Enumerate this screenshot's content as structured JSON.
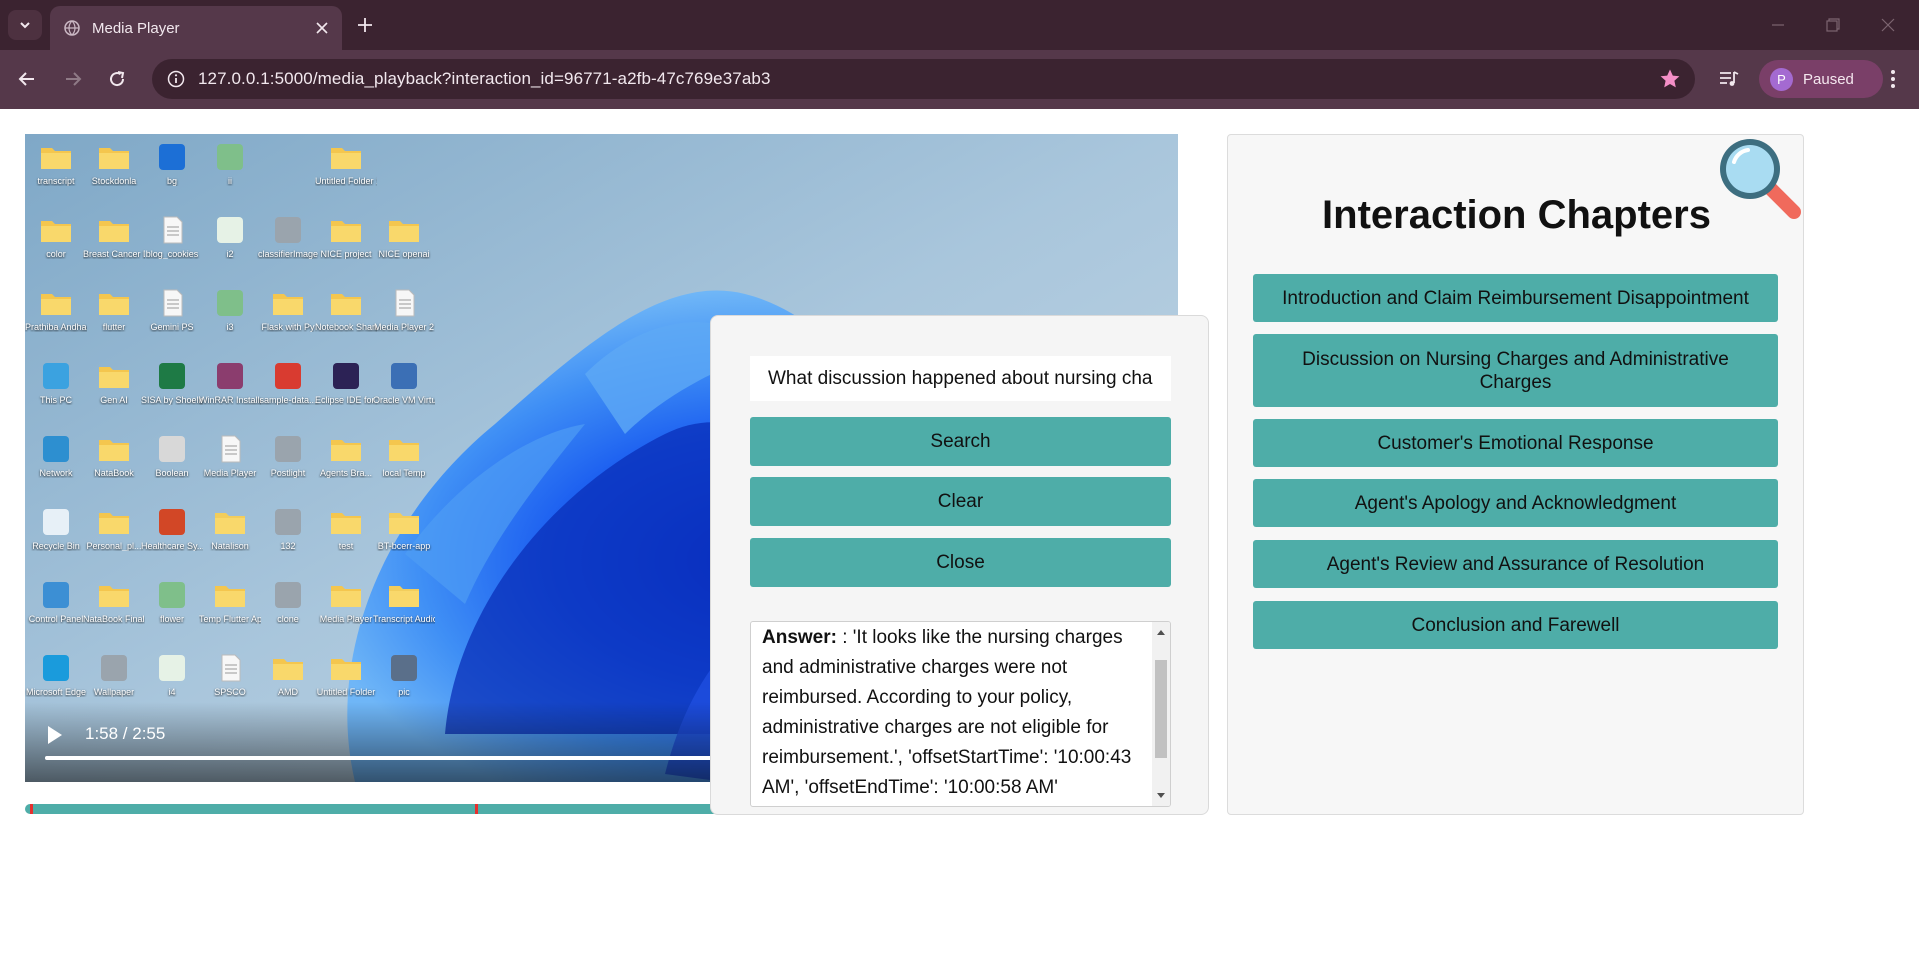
{
  "browser": {
    "tab_title": "Media Player",
    "url": "127.0.0.1:5000/media_playback?interaction_id=96771-a2fb-47c769e37ab3",
    "profile_initial": "P",
    "profile_label": "Paused",
    "accent_color": "#f48fc7"
  },
  "video": {
    "time_display": "1:58 / 2:55",
    "progress_fraction": 0.674,
    "desktop_icons": [
      {
        "label": "transcript",
        "icon": "folder-icon"
      },
      {
        "label": "Stockdonla",
        "icon": "folder-icon"
      },
      {
        "label": "bg",
        "icon": "phone-image-icon"
      },
      {
        "label": "ii",
        "icon": "app-icon"
      },
      {
        "label": "Untitled Folder 1",
        "icon": "folder-icon"
      },
      {
        "label": "color",
        "icon": "folder-icon"
      },
      {
        "label": "Breast Cancer Detection",
        "icon": "folder-icon"
      },
      {
        "label": "blog_cookies",
        "icon": "document-icon"
      },
      {
        "label": "i2",
        "icon": "check-app-icon"
      },
      {
        "label": "classifierImage",
        "icon": "image-icon"
      },
      {
        "label": "NICE project",
        "icon": "folder-icon"
      },
      {
        "label": "NICE openai",
        "icon": "folder-icon"
      },
      {
        "label": "Prathiba Andhare",
        "icon": "folder-icon"
      },
      {
        "label": "flutter",
        "icon": "folder-icon"
      },
      {
        "label": "Gemini PS",
        "icon": "document-icon"
      },
      {
        "label": "i3",
        "icon": "app-icon"
      },
      {
        "label": "Flask with Py",
        "icon": "folder-icon"
      },
      {
        "label": "Notebook Share",
        "icon": "folder-icon"
      },
      {
        "label": "Media Player 2",
        "icon": "document-icon"
      },
      {
        "label": "This PC",
        "icon": "monitor-icon"
      },
      {
        "label": "Gen AI",
        "icon": "folder-icon"
      },
      {
        "label": "SISA by Shoeline Di...",
        "icon": "excel-icon"
      },
      {
        "label": "WinRAR Installer",
        "icon": "archive-icon"
      },
      {
        "label": "sample-data...",
        "icon": "pdf-icon"
      },
      {
        "label": "Eclipse IDE for Java De...",
        "icon": "eclipse-icon"
      },
      {
        "label": "Oracle VM VirtualBox",
        "icon": "virtualbox-icon"
      },
      {
        "label": "Network",
        "icon": "network-icon"
      },
      {
        "label": "NataBook",
        "icon": "folder-icon"
      },
      {
        "label": "Boolean",
        "icon": "disc-icon"
      },
      {
        "label": "Media Player",
        "icon": "document-icon"
      },
      {
        "label": "Postlight",
        "icon": "image-icon"
      },
      {
        "label": "Agents Bra...",
        "icon": "folder-icon"
      },
      {
        "label": "local Temp",
        "icon": "folder-icon"
      },
      {
        "label": "Recycle Bin",
        "icon": "recycle-bin-icon"
      },
      {
        "label": "Personal_pl...",
        "icon": "folder-icon"
      },
      {
        "label": "Healthcare Sy...",
        "icon": "powerpoint-icon"
      },
      {
        "label": "Natalison",
        "icon": "zip-folder-icon"
      },
      {
        "label": "132",
        "icon": "image-icon"
      },
      {
        "label": "test",
        "icon": "folder-icon"
      },
      {
        "label": "BT-bcerr-app",
        "icon": "zip-folder-icon"
      },
      {
        "label": "Control Panel",
        "icon": "control-panel-icon"
      },
      {
        "label": "NataBook Final Project",
        "icon": "folder-icon"
      },
      {
        "label": "flower",
        "icon": "app-icon"
      },
      {
        "label": "Temp Flutter App",
        "icon": "folder-icon"
      },
      {
        "label": "clone",
        "icon": "image-icon"
      },
      {
        "label": "Media Player",
        "icon": "folder-icon"
      },
      {
        "label": "Transcript Audio",
        "icon": "zip-folder-icon"
      },
      {
        "label": "Microsoft Edge",
        "icon": "edge-icon"
      },
      {
        "label": "Wallpaper",
        "icon": "image-icon"
      },
      {
        "label": "i4",
        "icon": "check-app-icon"
      },
      {
        "label": "SPSCO",
        "icon": "document-icon"
      },
      {
        "label": "AMD",
        "icon": "folder-icon"
      },
      {
        "label": "Untitled Folder",
        "icon": "folder-icon"
      },
      {
        "label": "pic",
        "icon": "photo-icon"
      }
    ]
  },
  "chapter_timeline": {
    "marker_positions_fraction": [
      0.004,
      0.39
    ]
  },
  "search": {
    "query": "What discussion happened about nursing charges and administrative charges?",
    "search_label": "Search",
    "clear_label": "Clear",
    "close_label": "Close",
    "answer_label": "Answer:",
    "answer_text": ": 'It looks like the nursing charges and administrative charges were not reimbursed. According to your policy, administrative charges are not eligible for reimbursement.', 'offsetStartTime': '10:00:43 AM', 'offsetEndTime': '10:00:58 AM'"
  },
  "chapters": {
    "title": "Interaction Chapters",
    "items": [
      "Introduction and Claim Reimbursement Disappointment",
      "Discussion on Nursing Charges and Administrative Charges",
      "Customer's Emotional Response",
      "Agent's Apology and Acknowledgment",
      "Agent's Review and Assurance of Resolution",
      "Conclusion and Farewell"
    ]
  },
  "colors": {
    "teal": "#4eada8",
    "marker_red": "#e5302f"
  }
}
